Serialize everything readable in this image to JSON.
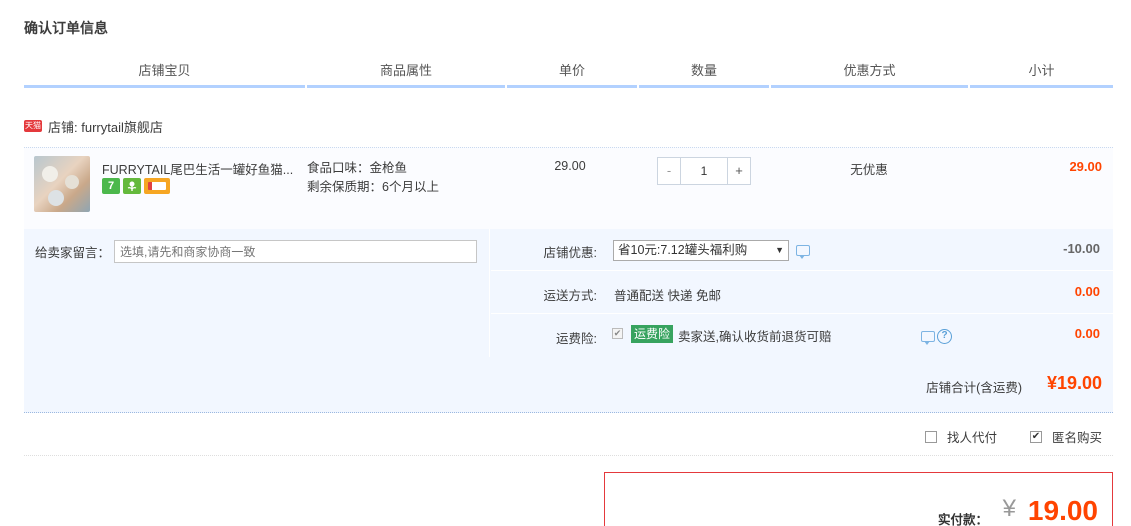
{
  "page_title": "确认订单信息",
  "table_headers": [
    "店铺宝贝",
    "商品属性",
    "单价",
    "数量",
    "优惠方式",
    "小计"
  ],
  "shop": {
    "badge": "天猫",
    "label": "店铺: furrytail旗舰店"
  },
  "item": {
    "title": "FURRYTAIL尾巴生活一罐好鱼猫...",
    "service_icons": [
      "seven-day-return-icon",
      "flower-guarantee-icon",
      "credit-card-icon"
    ],
    "service_seven_label": "7",
    "attr_flavor": "食品口味：金枪鱼",
    "attr_shelf_life": "剩余保质期：6个月以上",
    "unit_price": "29.00",
    "qty_minus": "-",
    "qty_value": "1",
    "qty_plus": "+",
    "promotion": "无优惠",
    "subtotal": "29.00"
  },
  "message": {
    "label": "给卖家留言：",
    "placeholder": "选填,请先和商家协商一致"
  },
  "shop_discount": {
    "label": "店铺优惠:",
    "selected": "省10元:7.12罐头福利购",
    "amount": "-10.00"
  },
  "shipping": {
    "label": "运送方式:",
    "method": "普通配送 快递 免邮",
    "amount": "0.00"
  },
  "insurance": {
    "label": "运费险:",
    "badge": "运费险",
    "desc": "卖家送,确认收货前退货可赔",
    "amount": "0.00",
    "checked_mark": "✔"
  },
  "shop_total": {
    "label": "店铺合计(含运费)",
    "value": "¥19.00"
  },
  "options": {
    "proxy_pay": "找人代付",
    "anonymous": "匿名购买",
    "check_mark": "✔"
  },
  "payment": {
    "label": "实付款：",
    "currency": "¥",
    "value": "19.00"
  },
  "colors": {
    "accent_red": "#ff4400",
    "header_border": "#b2d1ff",
    "panel_bg": "#f2f7ff"
  }
}
